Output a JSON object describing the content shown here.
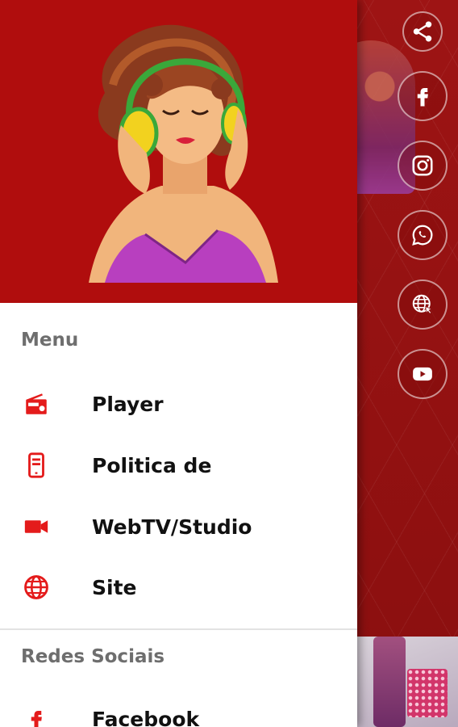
{
  "drawer": {
    "menu_header": "Menu",
    "menu_items": [
      {
        "label": "Player",
        "icon": "radio-icon"
      },
      {
        "label": "Politica de",
        "icon": "document-icon"
      },
      {
        "label": "WebTV/Studio",
        "icon": "videocam-icon"
      },
      {
        "label": "Site",
        "icon": "globe-icon"
      }
    ],
    "social_header": "Redes Sociais",
    "social_items": [
      {
        "label": "Facebook",
        "icon": "facebook-icon"
      }
    ]
  },
  "side_buttons": [
    {
      "icon": "share-icon"
    },
    {
      "icon": "facebook-icon"
    },
    {
      "icon": "instagram-icon"
    },
    {
      "icon": "whatsapp-icon"
    },
    {
      "icon": "website-icon"
    },
    {
      "icon": "youtube-icon"
    }
  ],
  "colors": {
    "accent": "#e41b1b",
    "header_bg": "#b00d0d",
    "app_bg": "#9e1414"
  }
}
